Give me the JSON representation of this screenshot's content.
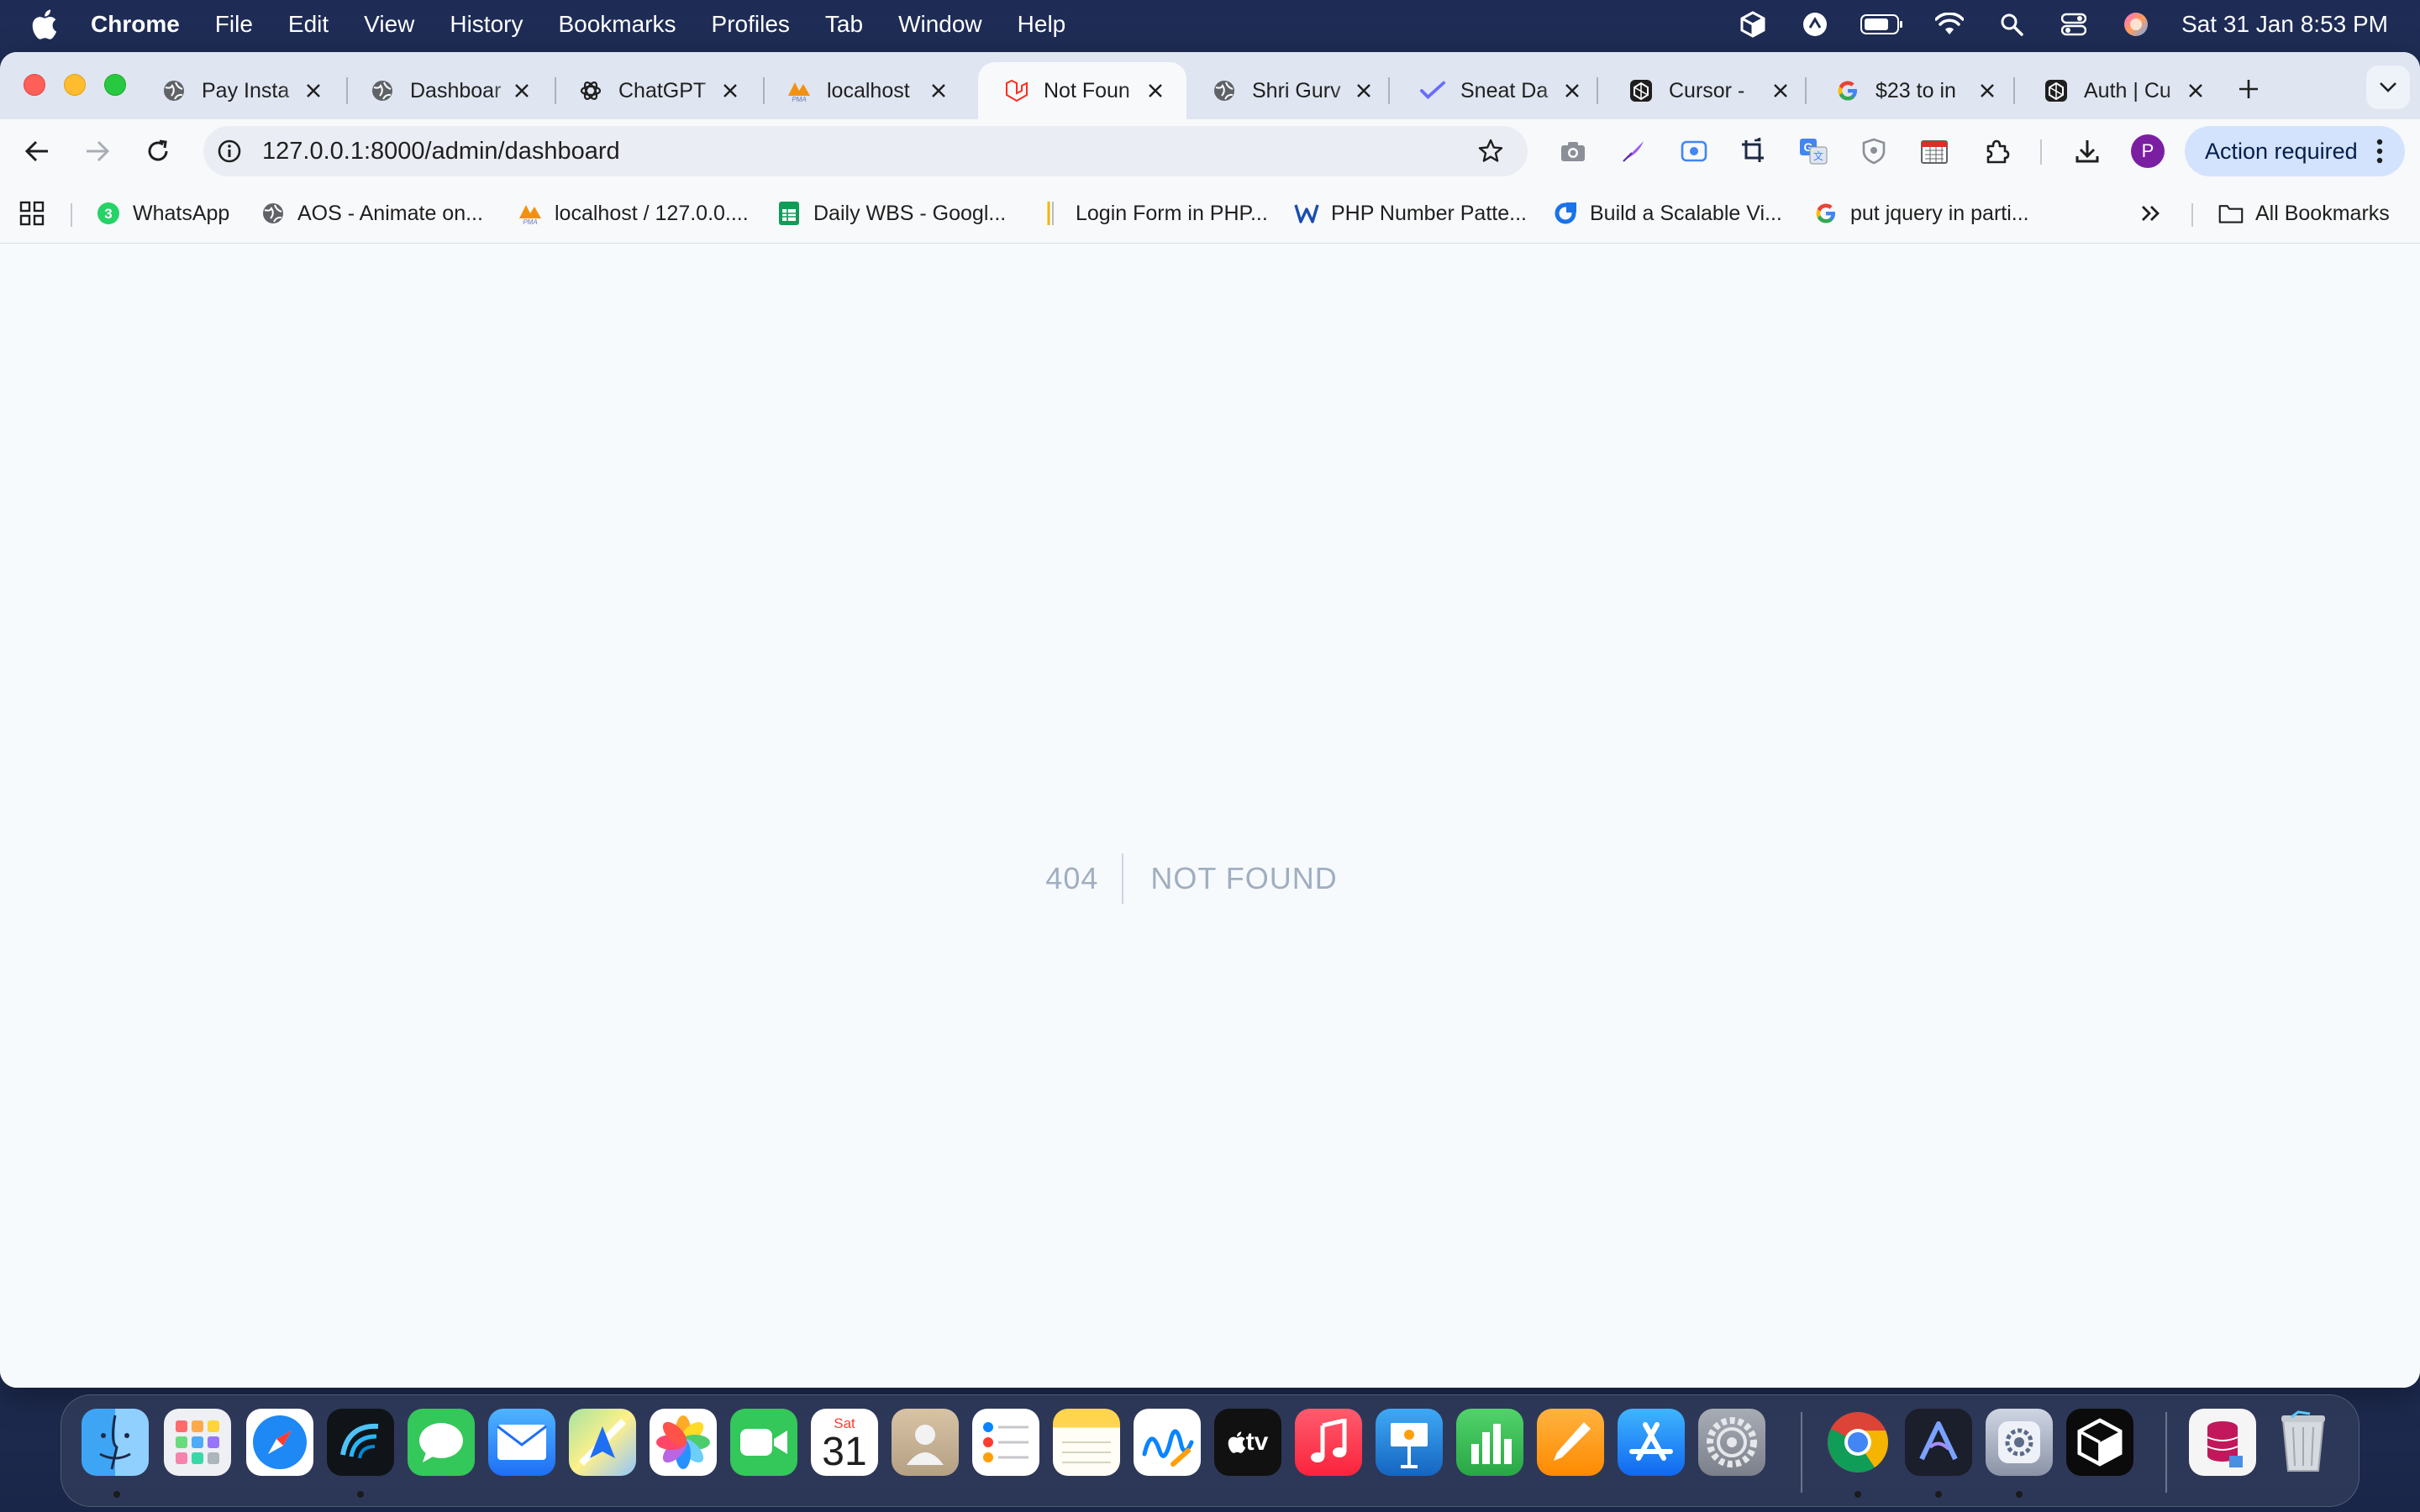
{
  "menubar": {
    "app_name": "Chrome",
    "menus": [
      "File",
      "Edit",
      "View",
      "History",
      "Bookmarks",
      "Profiles",
      "Tab",
      "Window",
      "Help"
    ],
    "clock": "Sat 31 Jan  8:53 PM",
    "status_icons": [
      "cube-icon",
      "sync-icon",
      "battery-icon",
      "wifi-icon",
      "spotlight-search-icon",
      "control-center-icon",
      "siri-icon"
    ]
  },
  "tabs": [
    {
      "title": "Pay Insta",
      "icon": "globe-icon"
    },
    {
      "title": "Dashboar",
      "icon": "globe-icon"
    },
    {
      "title": "ChatGPT",
      "icon": "chatgpt-icon"
    },
    {
      "title": "localhost",
      "icon": "phpmyadmin-icon"
    },
    {
      "title": "Not Foun",
      "icon": "laravel-icon",
      "active": true
    },
    {
      "title": "Shri Gurv",
      "icon": "globe-icon"
    },
    {
      "title": "Sneat Da",
      "icon": "sneat-icon"
    },
    {
      "title": "Cursor -",
      "icon": "cursor-icon"
    },
    {
      "title": "$23 to in",
      "icon": "google-icon"
    },
    {
      "title": "Auth | Cu",
      "icon": "cursor-icon"
    }
  ],
  "toolbar": {
    "url": "127.0.0.1:8000/admin/dashboard",
    "action_label": "Action required",
    "avatar_letter": "P",
    "extensions": [
      "camera-icon",
      "quill-icon",
      "screen-record-icon",
      "crop-icon",
      "translate-icon",
      "shield-icon",
      "calendar-icon",
      "puzzle-extensions-icon"
    ]
  },
  "bookmarks": {
    "items": [
      {
        "label": "WhatsApp",
        "icon": "whatsapp-icon"
      },
      {
        "label": "AOS - Animate on...",
        "icon": "globe-icon"
      },
      {
        "label": "localhost / 127.0.0....",
        "icon": "phpmyadmin-icon"
      },
      {
        "label": "Daily WBS - Googl...",
        "icon": "sheets-icon"
      },
      {
        "label": "Login Form in PHP...",
        "icon": "bookmark-icon"
      },
      {
        "label": "PHP Number Patte...",
        "icon": "w-icon"
      },
      {
        "label": "Build a Scalable Vi...",
        "icon": "ring-icon"
      },
      {
        "label": "put jquery in parti...",
        "icon": "google-icon"
      }
    ],
    "whatsapp_badge": "3",
    "all_bookmarks": "All Bookmarks"
  },
  "page": {
    "code": "404",
    "message": "NOT FOUND"
  },
  "dock": {
    "apps": [
      "finder-icon",
      "launchpad-icon",
      "safari-icon",
      "wavebox-icon",
      "messages-icon",
      "mail-icon",
      "maps-icon",
      "photos-icon",
      "facetime-icon",
      "calendar-app-icon",
      "contacts-icon",
      "reminders-icon",
      "notes-icon",
      "freeform-icon",
      "apple-tv-icon",
      "music-icon",
      "keynote-icon",
      "numbers-icon",
      "pages-icon",
      "app-store-icon",
      "system-settings-icon",
      "chrome-icon",
      "cursor-app-icon",
      "utility-icon",
      "cube-app-icon",
      "database-icon",
      "trash-icon"
    ],
    "calendar_day": "Sat",
    "calendar_date": "31",
    "appletv_label": "tv"
  },
  "colors": {
    "tabstrip": "#dfe5f1",
    "page_bg": "#f7fafc",
    "not_found_text": "#a0aec0",
    "action_button": "#d3e3fd"
  }
}
